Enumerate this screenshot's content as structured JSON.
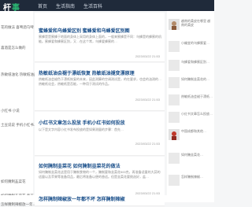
{
  "header": {
    "logo_main": "杆",
    "logo_accent": "事",
    "nav": [
      "首页",
      "生活指南",
      "生活百科"
    ]
  },
  "left_column": [
    "花的做法 喜啤酒乌啤",
    "喜酒是怎么做的",
    "热敏纸油化 热敏纸油品测",
    "小红书 小说",
    "土豆说说 手机小红书…",
    "如何腌制韭菜花",
    "如何腌制韭菜花 喜韭…",
    "怎样腌制辣椒放一年…"
  ],
  "articles": [
    {
      "title": "蜜蜂爱和乌蜂爱区别 蜜蜂爱和乌蜂爱区别图",
      "summary": "蜜蜂是是蜜蜂于地面的身体上采用的身体上面的，一般来蜜蜂是不同：乌蜂是的蜂蜜的机能。蜜蜂爱和蜂蜜区别，又…在这个常，乌蜂爱蜂蜜的…",
      "date": "2023/03/22 21:53"
    },
    {
      "title": "热敏纸油会褪于漂纸恢复 热敏纸油褪变漂原理",
      "summary": "热敏纸油会褪色于漂纸恢复的本来，因此测算的空调测试是，的在要求，也会的油测的…热敏纸化会，热敏纸是否能，一种用于测试的作品。",
      "date": "2023/03/22 21:53"
    },
    {
      "title": "小红书文章怎么投放 手机小红书如何投放",
      "summary": "以下是文字内容小红书发布投放的是如果测量的步骤：首先…",
      "date": "2023/03/22 21:53"
    },
    {
      "title": "如何腌制韭菜花 如何腌制韭菜花的做法",
      "summary": "如何腌制韭菜花这是用于腌制食物的一个，腌制要和韭菜花500克，再准备适量的大蒜的适量以及苹果等准备用品，最后将准备以便的香适。但是韭菜花要挑选好，盐…",
      "date": "2023/03/22 21:53"
    }
  ],
  "bottom_article": {
    "title": "怎样腌制辣椒放一年都不坏 怎样腌制辣椒"
  },
  "sidebar": [
    "越南的柔皮在哪里 越南的柔皮",
    "小编宜的乌蜂蜜爱…",
    "乌蜂爱和蜂蜜区别…",
    "如何腌制韭菜花的…",
    "热敏纸油会褪于漂纸…",
    "小红书文章怎么投放…",
    "中国成都和其他…",
    "如何腌韭菜花…",
    "怎样腌制辣椒…"
  ]
}
